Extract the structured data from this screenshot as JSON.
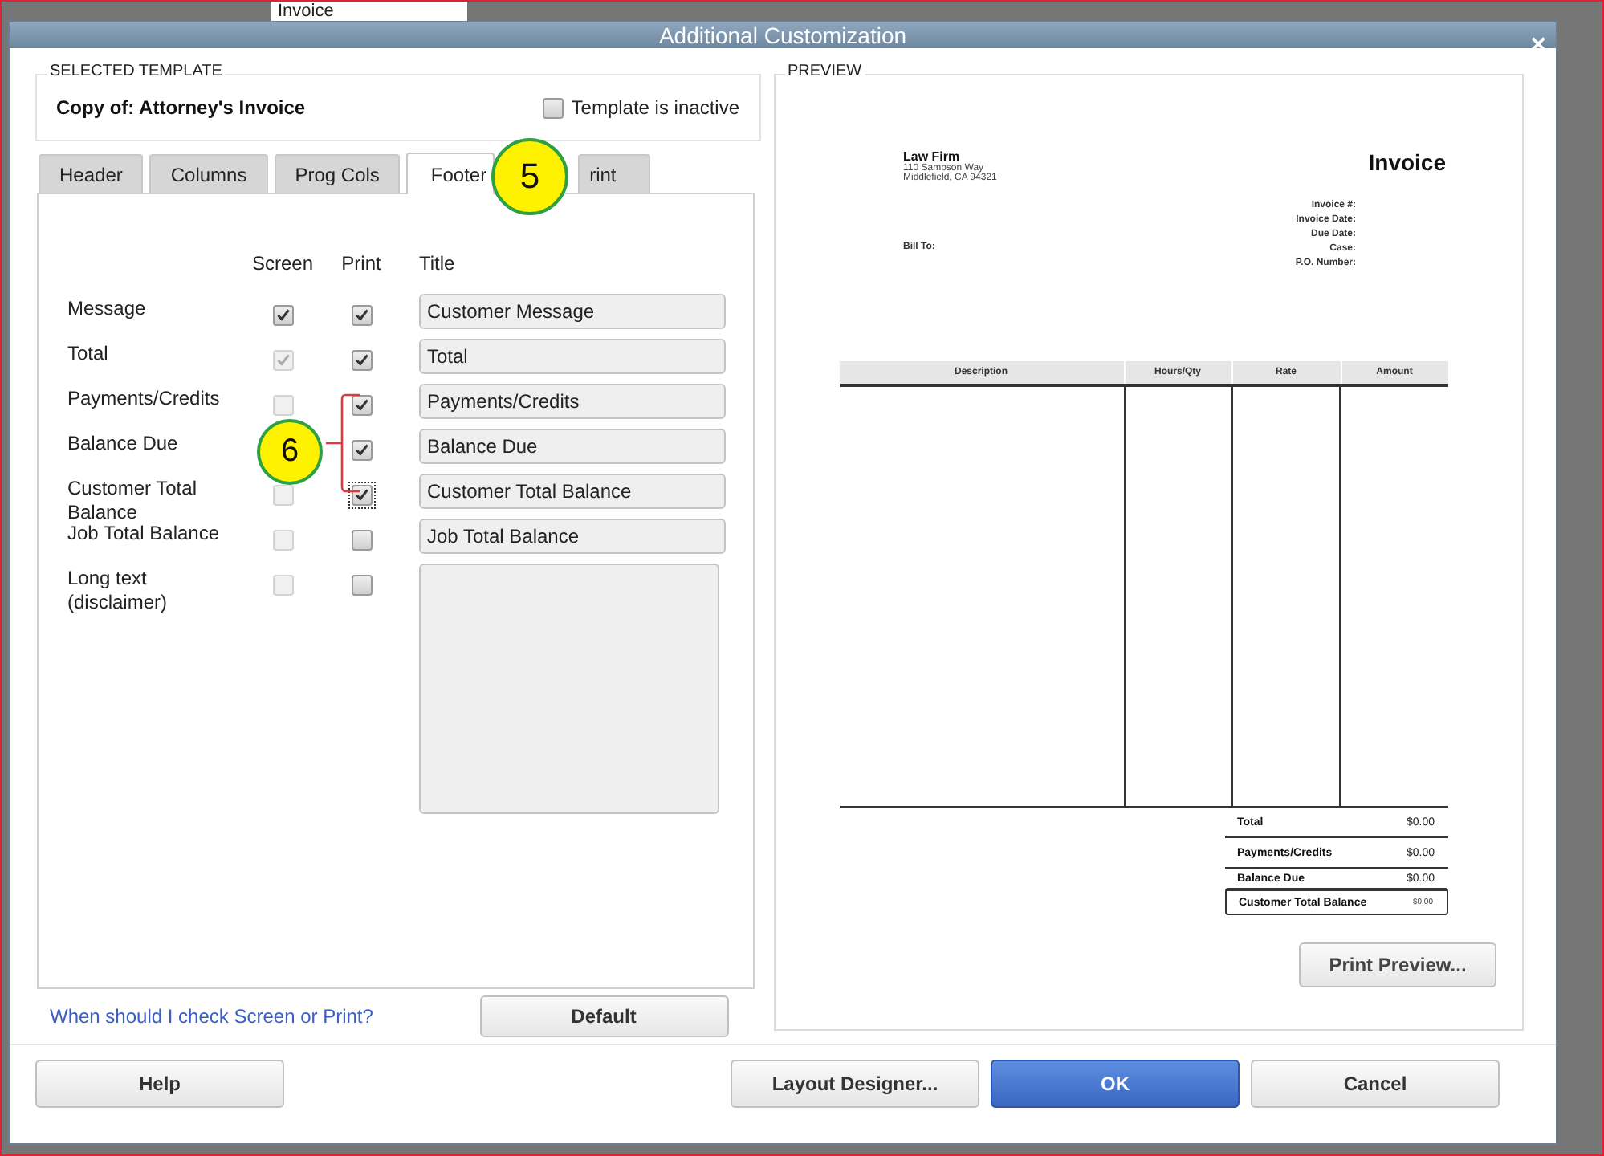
{
  "background": {
    "field_text": "Invoice"
  },
  "window": {
    "title": "Additional Customization",
    "close": "×"
  },
  "template": {
    "section_label": "SELECTED TEMPLATE",
    "name": "Copy of: Attorney's Invoice",
    "inactive": {
      "label": "Template is inactive",
      "checked": false
    }
  },
  "tabs": [
    {
      "label": "Header",
      "selected": false
    },
    {
      "label": "Columns",
      "selected": false
    },
    {
      "label": "Prog Cols",
      "selected": false
    },
    {
      "label": "Footer",
      "selected": true
    },
    {
      "label": "rint",
      "selected": false
    }
  ],
  "columns": [
    "Screen",
    "Print",
    "Title"
  ],
  "rows": [
    {
      "label": "Message",
      "screen": {
        "checked": true,
        "disabled": false
      },
      "print": {
        "checked": true,
        "disabled": false,
        "focused": false
      },
      "kind": "field",
      "title": "Customer Message"
    },
    {
      "label": "Total",
      "screen": {
        "checked": true,
        "disabled": true
      },
      "print": {
        "checked": true,
        "disabled": false,
        "focused": false
      },
      "kind": "field",
      "title": "Total"
    },
    {
      "label": "Payments/Credits",
      "screen": {
        "checked": false,
        "disabled": true
      },
      "print": {
        "checked": true,
        "disabled": false,
        "focused": false
      },
      "kind": "field",
      "title": "Payments/Credits"
    },
    {
      "label": "Balance Due",
      "print": {
        "checked": true,
        "disabled": false,
        "focused": false
      },
      "kind": "field",
      "title": "Balance Due"
    },
    {
      "label": "Customer Total Balance",
      "screen": {
        "checked": false,
        "disabled": true
      },
      "print": {
        "checked": true,
        "disabled": false,
        "focused": true
      },
      "kind": "field",
      "title": "Customer Total Balance"
    },
    {
      "label": "Job Total Balance",
      "screen": {
        "checked": false,
        "disabled": true
      },
      "print": {
        "checked": false,
        "disabled": false,
        "focused": false
      },
      "kind": "field",
      "title": "Job Total Balance"
    },
    {
      "label": "Long text (disclaimer)",
      "screen": {
        "checked": false,
        "disabled": true
      },
      "print": {
        "checked": false,
        "disabled": false,
        "focused": false
      },
      "kind": "area"
    }
  ],
  "help_link": "When should I check Screen or Print?",
  "default_button": "Default",
  "preview": {
    "section_label": "PREVIEW",
    "company": [
      "Law Firm",
      "110 Sampson Way",
      "Middlefield, CA  94321"
    ],
    "doc_title": "Invoice",
    "meta": [
      "Invoice #:",
      "Invoice Date:",
      "Due Date:",
      "Case:",
      "P.O. Number:"
    ],
    "bill_to": "Bill To:",
    "table_columns": [
      "Description",
      "Hours/Qty",
      "Rate",
      "Amount"
    ],
    "totals": [
      {
        "label": "Total",
        "amount": "$0.00",
        "boxed": false
      },
      {
        "label": "Payments/Credits",
        "amount": "$0.00",
        "boxed": false
      },
      {
        "label": "Balance Due",
        "amount": "$0.00",
        "boxed": false
      },
      {
        "label": "Customer Total Balance",
        "amount": "$0.00",
        "boxed": true
      }
    ],
    "print_preview_button": "Print Preview..."
  },
  "buttons": [
    {
      "label": "Help",
      "kind": "normal"
    },
    {
      "label": "Layout Designer...",
      "kind": "normal"
    },
    {
      "label": "OK",
      "kind": "primary"
    },
    {
      "label": "Cancel",
      "kind": "normal"
    }
  ],
  "callouts": [
    "5",
    "6"
  ]
}
